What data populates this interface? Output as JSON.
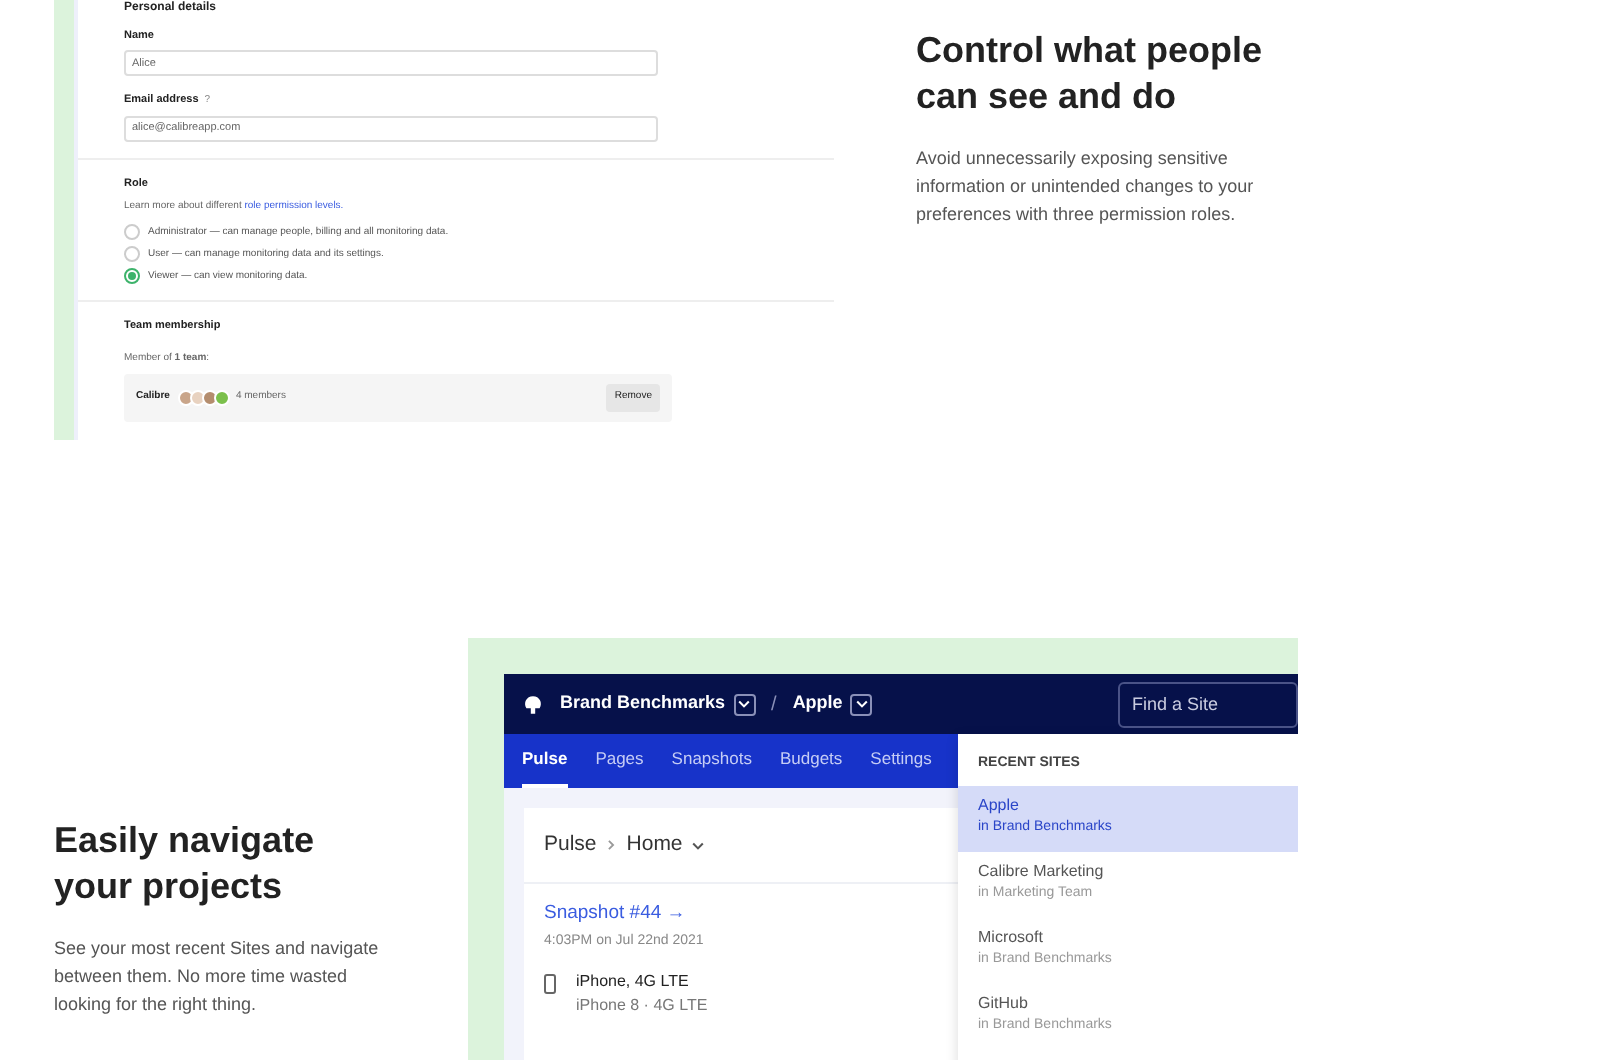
{
  "personal_form": {
    "section_title": "Personal details",
    "name_label": "Name",
    "name_value": "Alice",
    "email_label": "Email address",
    "email_help": "?",
    "email_value": "alice@calibreapp.com",
    "role_title": "Role",
    "role_intro": "Learn more about different ",
    "role_link": "role permission levels.",
    "roles": [
      {
        "label": "Administrator — can manage people, billing and all monitoring data.",
        "selected": false
      },
      {
        "label": "User — can manage monitoring data and its settings.",
        "selected": false
      },
      {
        "label": "Viewer — can view monitoring data.",
        "selected": true
      }
    ],
    "team_title": "Team membership",
    "team_summary": "Member of **1 team**:",
    "team": {
      "name": "Calibre",
      "members": "4 members",
      "button": "Remove"
    }
  },
  "feature_1": {
    "title": "Control what people can see and do",
    "body": "Avoid unnecessarily exposing sensitive information or unintended changes to your preferences with three permission roles."
  },
  "feature_2": {
    "title": "Easily navigate your projects",
    "body": "See your most recent Sites and navigate between them. No more time wasted looking for the right thing."
  },
  "app": {
    "org": "Brand Benchmarks",
    "separator": "/",
    "site": "Apple",
    "search_placeholder": "Find a Site",
    "tabs": [
      {
        "label": "Pulse",
        "selected": true
      },
      {
        "label": "Pages",
        "selected": false
      },
      {
        "label": "Snapshots",
        "selected": false
      },
      {
        "label": "Budgets",
        "selected": false
      },
      {
        "label": "Settings",
        "selected": false
      }
    ],
    "breadcrumb": [
      "Pulse",
      "Home"
    ],
    "snapshot_link": "Snapshot #44 →",
    "snapshot_time": "4:03PM on Jul 22nd 2021",
    "device": {
      "name": "iPhone, 4G LTE",
      "detail": "iPhone 8 · 4G LTE"
    },
    "recent_title": "RECENT SITES",
    "recent_sites": [
      {
        "name": "Apple",
        "team": "in Brand Benchmarks",
        "selected": true
      },
      {
        "name": "Calibre Marketing",
        "team": "in Marketing Team",
        "selected": false
      },
      {
        "name": "Microsoft",
        "team": "in Brand Benchmarks",
        "selected": false
      },
      {
        "name": "GitHub",
        "team": "in Brand Benchmarks",
        "selected": false
      }
    ]
  }
}
